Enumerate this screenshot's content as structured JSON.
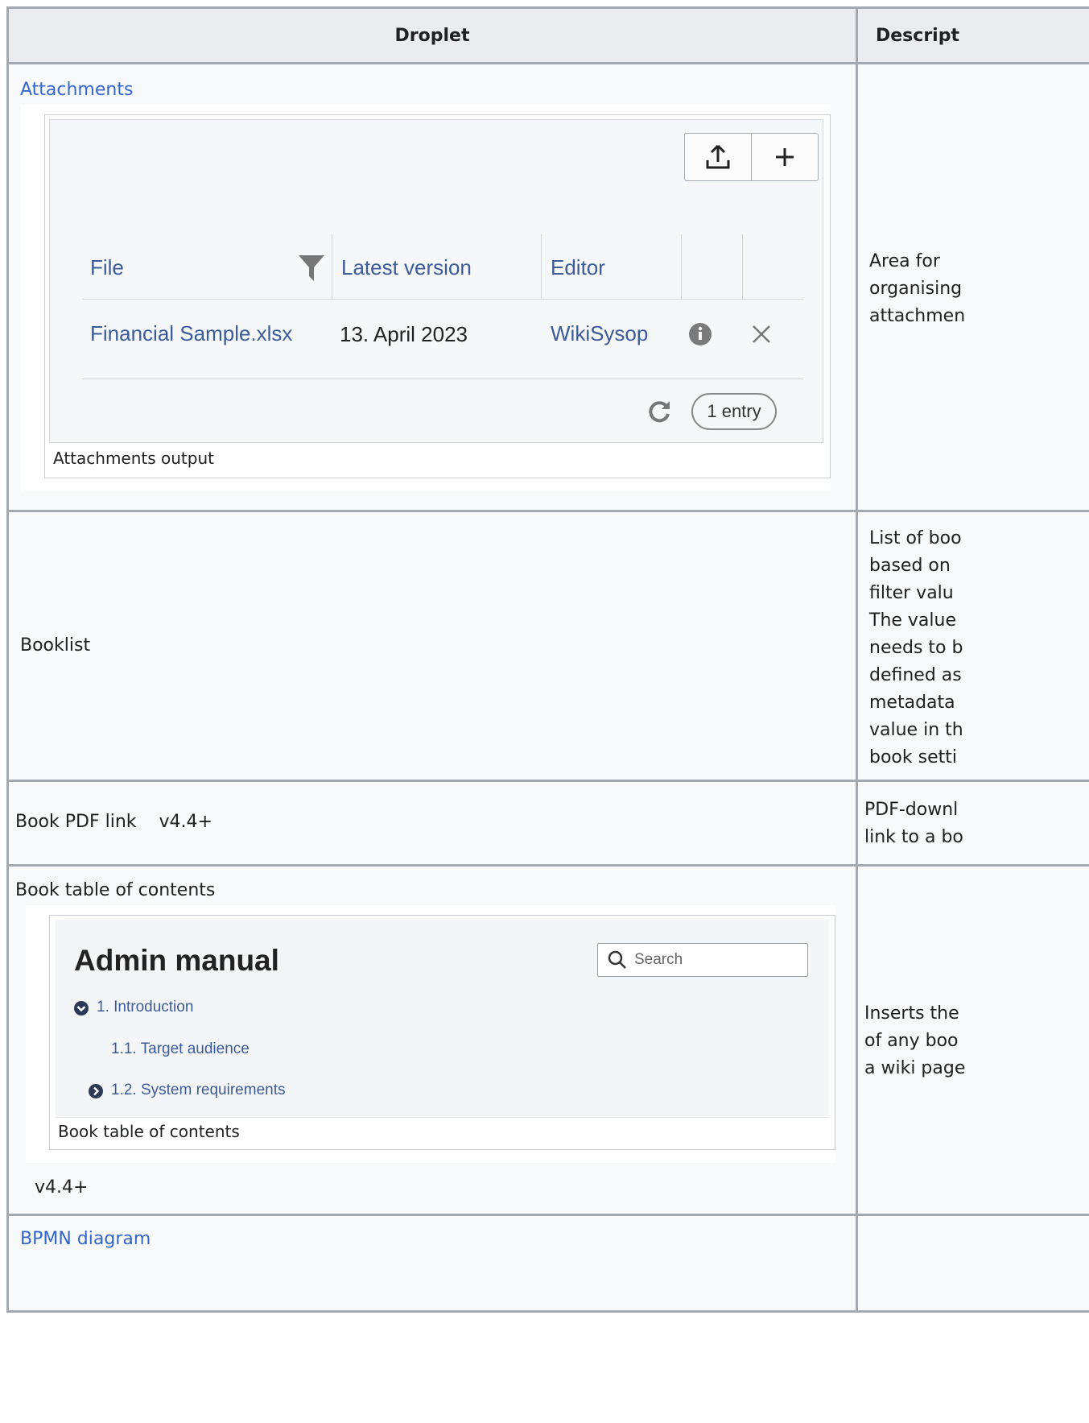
{
  "table": {
    "headers": [
      "Droplet",
      "Descript"
    ],
    "rows": {
      "attachments": {
        "title": "Attachments",
        "caption": "Attachments output",
        "description": [
          "Area for",
          "organising",
          "attachmen"
        ],
        "screenshot": {
          "columns": [
            "File",
            "Latest version",
            "Editor"
          ],
          "row": {
            "file": "Financial Sample.xlsx",
            "version": "13. April 2023",
            "editor": "WikiSysop"
          },
          "count": "1 entry",
          "icons": [
            "upload-icon",
            "plus-icon",
            "filter-icon",
            "info-icon",
            "close-icon",
            "refresh-icon"
          ]
        }
      },
      "booklist": {
        "title": "Booklist",
        "description": [
          "List of boo",
          "based on",
          "filter valu",
          "The value",
          "needs to b",
          "defined as",
          "metadata",
          "value in th",
          "book setti"
        ]
      },
      "book_pdf": {
        "title": "Book PDF link",
        "version": "v4.4+",
        "description": [
          "PDF-downl",
          "link to a bo"
        ]
      },
      "book_toc": {
        "title": "Book table of contents",
        "caption": "Book table of contents",
        "version": "v4.4+",
        "description": [
          "Inserts the",
          "of any boo",
          "a wiki page"
        ],
        "screenshot": {
          "heading": "Admin manual",
          "search_placeholder": "Search",
          "items": [
            "1. Introduction",
            "1.1. Target audience",
            "1.2. System requirements"
          ],
          "icons": [
            "chevron-down-circle-icon",
            "chevron-right-circle-icon",
            "search-icon"
          ]
        }
      },
      "bpmn": {
        "title": "BPMN diagram"
      }
    }
  }
}
